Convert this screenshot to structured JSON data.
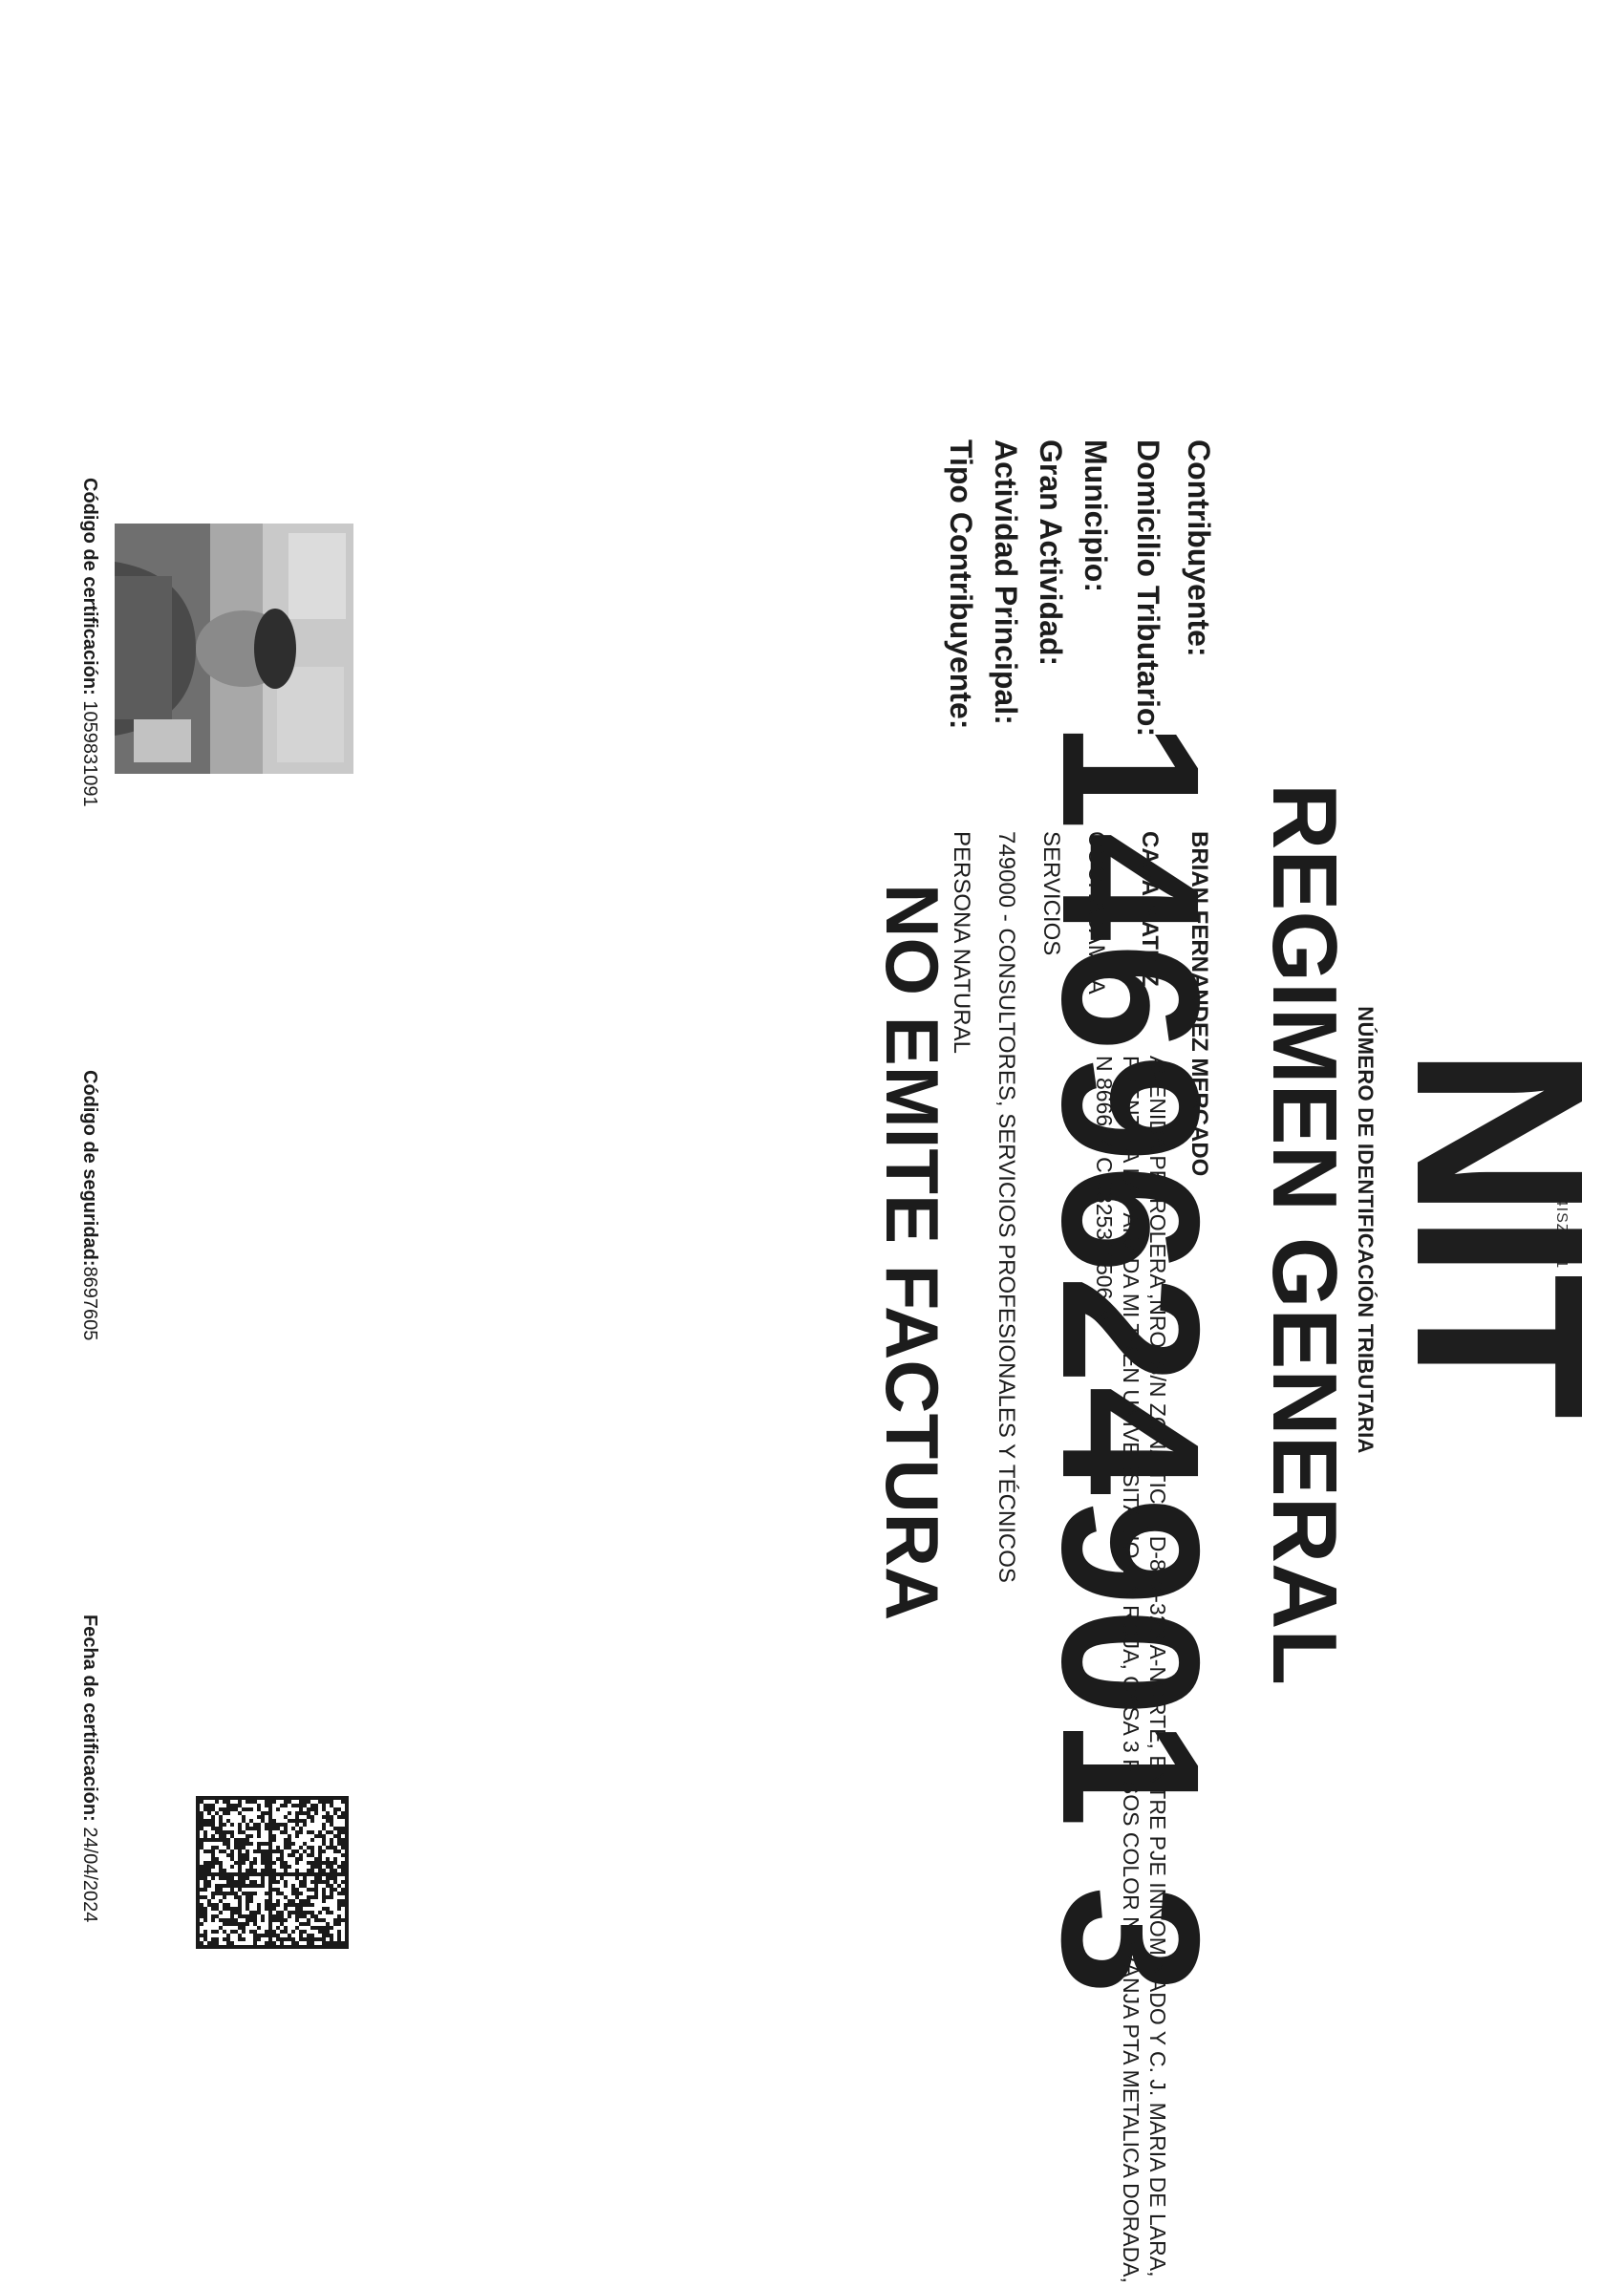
{
  "header": {
    "serial": "I-4ISZIH11",
    "logo": "NIT",
    "subtitle": "NÚMERO DE IDENTIFICACIÓN TRIBUTARIA",
    "regime": "REGIMEN GENERAL",
    "nit_number": "1469624901 3",
    "factura_status": "NO EMITE FACTURA"
  },
  "fields": {
    "contribuyente_label": "Contribuyente:",
    "contribuyente_value": "BRIAN FERNANDEZ MERCADO",
    "domicilio_label": "Domicilio Tributario:",
    "domicilio_type": "CASA MATRIZ",
    "domicilio_address": "AVENIDA PETROLERA ,NRO: S/N ZONA TICTI, D-8 M-323 A-NORTE, ENTRE PJE INNOMINADO Y C. J. MARIA DE LARA, FRENTE A LA PARADA MI TREN UNIVERSITARIO LIN ROJA, CASA 3 PISOS COLOR NARANJA PTA METALICA DORADA, N 866644 C 0325311506 M",
    "municipio_label": "Municipio:",
    "municipio_value": "COCHABAMBA",
    "gran_actividad_label": "Gran Actividad:",
    "gran_actividad_value": "SERVICIOS",
    "actividad_label": "Actividad Principal:",
    "actividad_value": "749000 - CONSULTORES, SERVICIOS PROFESIONALES Y TÉCNICOS",
    "tipo_label": "Tipo Contribuyente:",
    "tipo_value": "PERSONA NATURAL"
  },
  "footer": {
    "cert_code_label": "Código de certificación:",
    "cert_code_value": "1059831091",
    "security_label": "Código de seguridad:",
    "security_value": "8697605",
    "cert_date_label": "Fecha de certificación:",
    "cert_date_value": "24/04/2024"
  },
  "colors": {
    "ink": "#1c1c1c",
    "paper": "#ffffff"
  },
  "icons": {
    "photo": "taxpayer-photo",
    "barcode": "2d-barcode"
  }
}
